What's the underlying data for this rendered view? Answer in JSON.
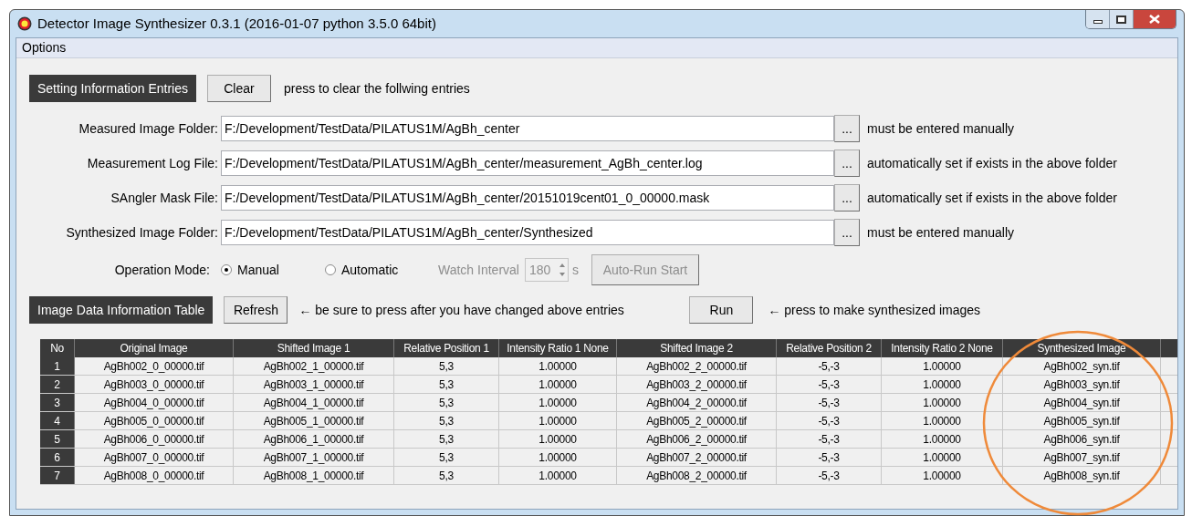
{
  "window": {
    "title": "Detector Image Synthesizer 0.3.1 (2016-01-07 python 3.5.0 64bit)"
  },
  "menu": [
    "Options"
  ],
  "settings_section": {
    "title": "Setting Information Entries",
    "clear_button": "Clear",
    "hint": "press to clear the follwing entries"
  },
  "entries": [
    {
      "label": "Measured Image Folder:",
      "value": "F:/Development/TestData/PILATUS1M/AgBh_center",
      "browse": "...",
      "note": "must be entered manually"
    },
    {
      "label": "Measurement Log File:",
      "value": "F:/Development/TestData/PILATUS1M/AgBh_center/measurement_AgBh_center.log",
      "browse": "...",
      "note": "automatically set if exists in the above folder"
    },
    {
      "label": "SAngler Mask File:",
      "value": "F:/Development/TestData/PILATUS1M/AgBh_center/20151019cent01_0_00000.mask",
      "browse": "...",
      "note": "automatically set if exists in the above folder"
    },
    {
      "label": "Synthesized Image Folder:",
      "value": "F:/Development/TestData/PILATUS1M/AgBh_center/Synthesized",
      "browse": "...",
      "note": "must be entered manually"
    }
  ],
  "operation_mode": {
    "label": "Operation Mode:",
    "options": [
      {
        "label": "Manual",
        "selected": true
      },
      {
        "label": "Automatic",
        "selected": false
      }
    ],
    "watch_interval": {
      "label": "Watch Interval",
      "value": "180",
      "unit": "s",
      "disabled": true
    },
    "auto_run_button": {
      "label": "Auto-Run Start",
      "disabled": true
    }
  },
  "table_section": {
    "title": "Image Data Information Table",
    "refresh_button": "Refresh",
    "refresh_hint": "← be sure to press after you have changed above entries",
    "run_button": "Run",
    "run_hint": "← press to make synthesized images"
  },
  "table": {
    "columns": [
      "No",
      "Original Image",
      "Shifted Image 1",
      "Relative Position 1",
      "Intensity Ratio 1 None",
      "Shifted Image 2",
      "Relative Position 2",
      "Intensity Ratio 2 None",
      "Synthesized Image"
    ],
    "rows": [
      [
        "1",
        "AgBh002_0_00000.tif",
        "AgBh002_1_00000.tif",
        "5,3",
        "1.00000",
        "AgBh002_2_00000.tif",
        "-5,-3",
        "1.00000",
        "AgBh002_syn.tif"
      ],
      [
        "2",
        "AgBh003_0_00000.tif",
        "AgBh003_1_00000.tif",
        "5,3",
        "1.00000",
        "AgBh003_2_00000.tif",
        "-5,-3",
        "1.00000",
        "AgBh003_syn.tif"
      ],
      [
        "3",
        "AgBh004_0_00000.tif",
        "AgBh004_1_00000.tif",
        "5,3",
        "1.00000",
        "AgBh004_2_00000.tif",
        "-5,-3",
        "1.00000",
        "AgBh004_syn.tif"
      ],
      [
        "4",
        "AgBh005_0_00000.tif",
        "AgBh005_1_00000.tif",
        "5,3",
        "1.00000",
        "AgBh005_2_00000.tif",
        "-5,-3",
        "1.00000",
        "AgBh005_syn.tif"
      ],
      [
        "5",
        "AgBh006_0_00000.tif",
        "AgBh006_1_00000.tif",
        "5,3",
        "1.00000",
        "AgBh006_2_00000.tif",
        "-5,-3",
        "1.00000",
        "AgBh006_syn.tif"
      ],
      [
        "6",
        "AgBh007_0_00000.tif",
        "AgBh007_1_00000.tif",
        "5,3",
        "1.00000",
        "AgBh007_2_00000.tif",
        "-5,-3",
        "1.00000",
        "AgBh007_syn.tif"
      ],
      [
        "7",
        "AgBh008_0_00000.tif",
        "AgBh008_1_00000.tif",
        "5,3",
        "1.00000",
        "AgBh008_2_00000.tif",
        "-5,-3",
        "1.00000",
        "AgBh008_syn.tif"
      ]
    ]
  }
}
